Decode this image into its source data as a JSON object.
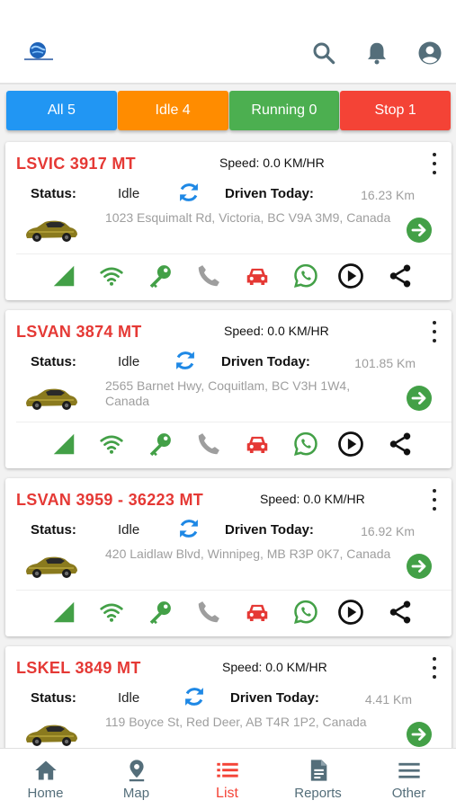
{
  "header": {
    "logo_icon": "globe-logo-icon",
    "search_icon": "search-icon",
    "notification_icon": "bell-icon",
    "account_icon": "account-circle-icon"
  },
  "tabs": [
    {
      "label": "All 5",
      "color": "#2196f3"
    },
    {
      "label": "Idle 4",
      "color": "#ff8c00"
    },
    {
      "label": "Running 0",
      "color": "#4caf50"
    },
    {
      "label": "Stop 1",
      "color": "#f44336"
    }
  ],
  "labels": {
    "status": "Status:",
    "driven_today": "Driven Today:"
  },
  "vehicles": [
    {
      "plate": "LSVIC 3917 MT",
      "speed": "Speed: 0.0 KM/HR",
      "status": "Idle",
      "driven": "16.23 Km",
      "address": "1023 Esquimalt Rd, Victoria, BC V9A 3M9, Canada"
    },
    {
      "plate": "LSVAN 3874 MT",
      "speed": "Speed: 0.0 KM/HR",
      "status": "Idle",
      "driven": "101.85 Km",
      "address": "2565 Barnet Hwy, Coquitlam, BC V3H 1W4, Canada"
    },
    {
      "plate": "LSVAN 3959 - 36223 MT",
      "speed": "Speed: 0.0 KM/HR",
      "status": "Idle",
      "driven": "16.92 Km",
      "address": "420 Laidlaw Blvd, Winnipeg, MB R3P 0K7, Canada"
    },
    {
      "plate": "LSKEL 3849 MT",
      "speed": "Speed: 0.0 KM/HR",
      "status": "Idle",
      "driven": "4.41 Km",
      "address": "119 Boyce St, Red Deer, AB T4R 1P2, Canada"
    }
  ],
  "action_icons": [
    "signal-icon",
    "wifi-icon",
    "ignition-key-icon",
    "phone-icon",
    "car-icon",
    "whatsapp-icon",
    "playback-icon",
    "share-icon"
  ],
  "colors": {
    "plate": "#e53935",
    "green": "#43a047",
    "grey_icon": "#9e9e9e",
    "red_icon": "#e53935",
    "refresh": "#1e88e5",
    "nav_active": "#f44336",
    "nav_inactive": "#546e7a"
  },
  "nav": [
    {
      "label": "Home",
      "icon": "home-icon",
      "active": false
    },
    {
      "label": "Map",
      "icon": "map-pin-icon",
      "active": false
    },
    {
      "label": "List",
      "icon": "list-icon",
      "active": true
    },
    {
      "label": "Reports",
      "icon": "document-icon",
      "active": false
    },
    {
      "label": "Other",
      "icon": "menu-icon",
      "active": false
    }
  ]
}
